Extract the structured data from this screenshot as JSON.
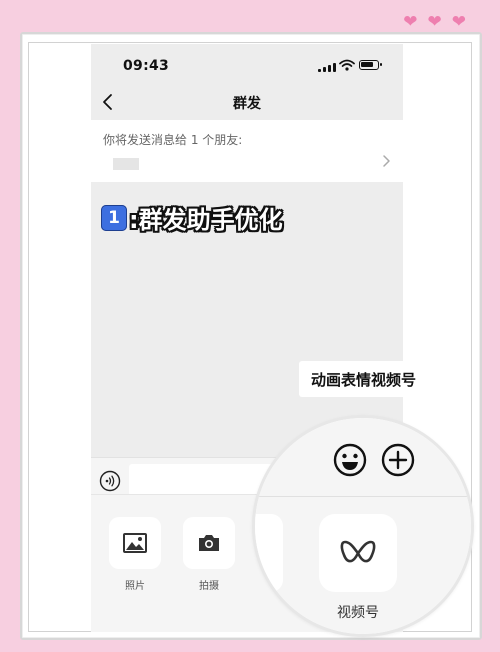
{
  "status_bar": {
    "time": "09:43"
  },
  "nav": {
    "title": "群发"
  },
  "recipients": {
    "label": "你将发送消息给 1 个朋友:"
  },
  "headline": {
    "keycap": "1",
    "text": ":群发助手优化"
  },
  "callout": {
    "text": "动画表情视频号"
  },
  "tools": [
    {
      "label": "照片",
      "icon": "image-icon"
    },
    {
      "label": "拍摄",
      "icon": "camera-icon"
    }
  ],
  "magnified": {
    "channels_label": "视频号"
  },
  "decor": {
    "hearts": 3,
    "accent_color": "#ee7faf",
    "background_color": "#f7cfe0"
  }
}
